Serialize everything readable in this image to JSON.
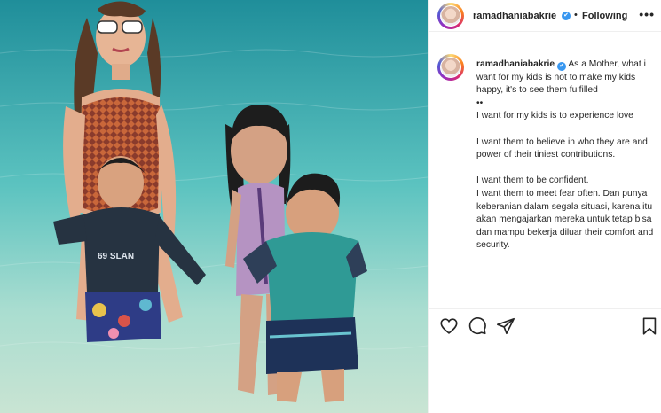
{
  "post": {
    "username": "ramadhaniabakrie",
    "separator": "•",
    "follow_label": "Following",
    "more_label": "•••"
  },
  "caption": {
    "username": "ramadhaniabakrie",
    "text": "As a Mother, what i want for my kids is not to make my kids happy, it's to see them fulfilled\n••\nI want for my kids is to experience love\n\nI want them to believe in who they are and power of their tiniest contributions.\n\nI want them to be confident.\nI want them to meet fear often. Dan punya keberanian dalam segala situasi, karena itu akan mengajarkan mereka untuk tetap bisa dan mampu bekerja diluar their comfort and security."
  },
  "photo": {
    "shirt_text": "69 SLAN"
  },
  "icons": {
    "like": "heart-icon",
    "comment": "comment-icon",
    "share": "share-icon",
    "save": "bookmark-icon",
    "verified": "verified-badge-icon",
    "more": "more-options-icon"
  },
  "colors": {
    "verified": "#3897f0",
    "text": "#262626",
    "divider": "#efefef"
  }
}
